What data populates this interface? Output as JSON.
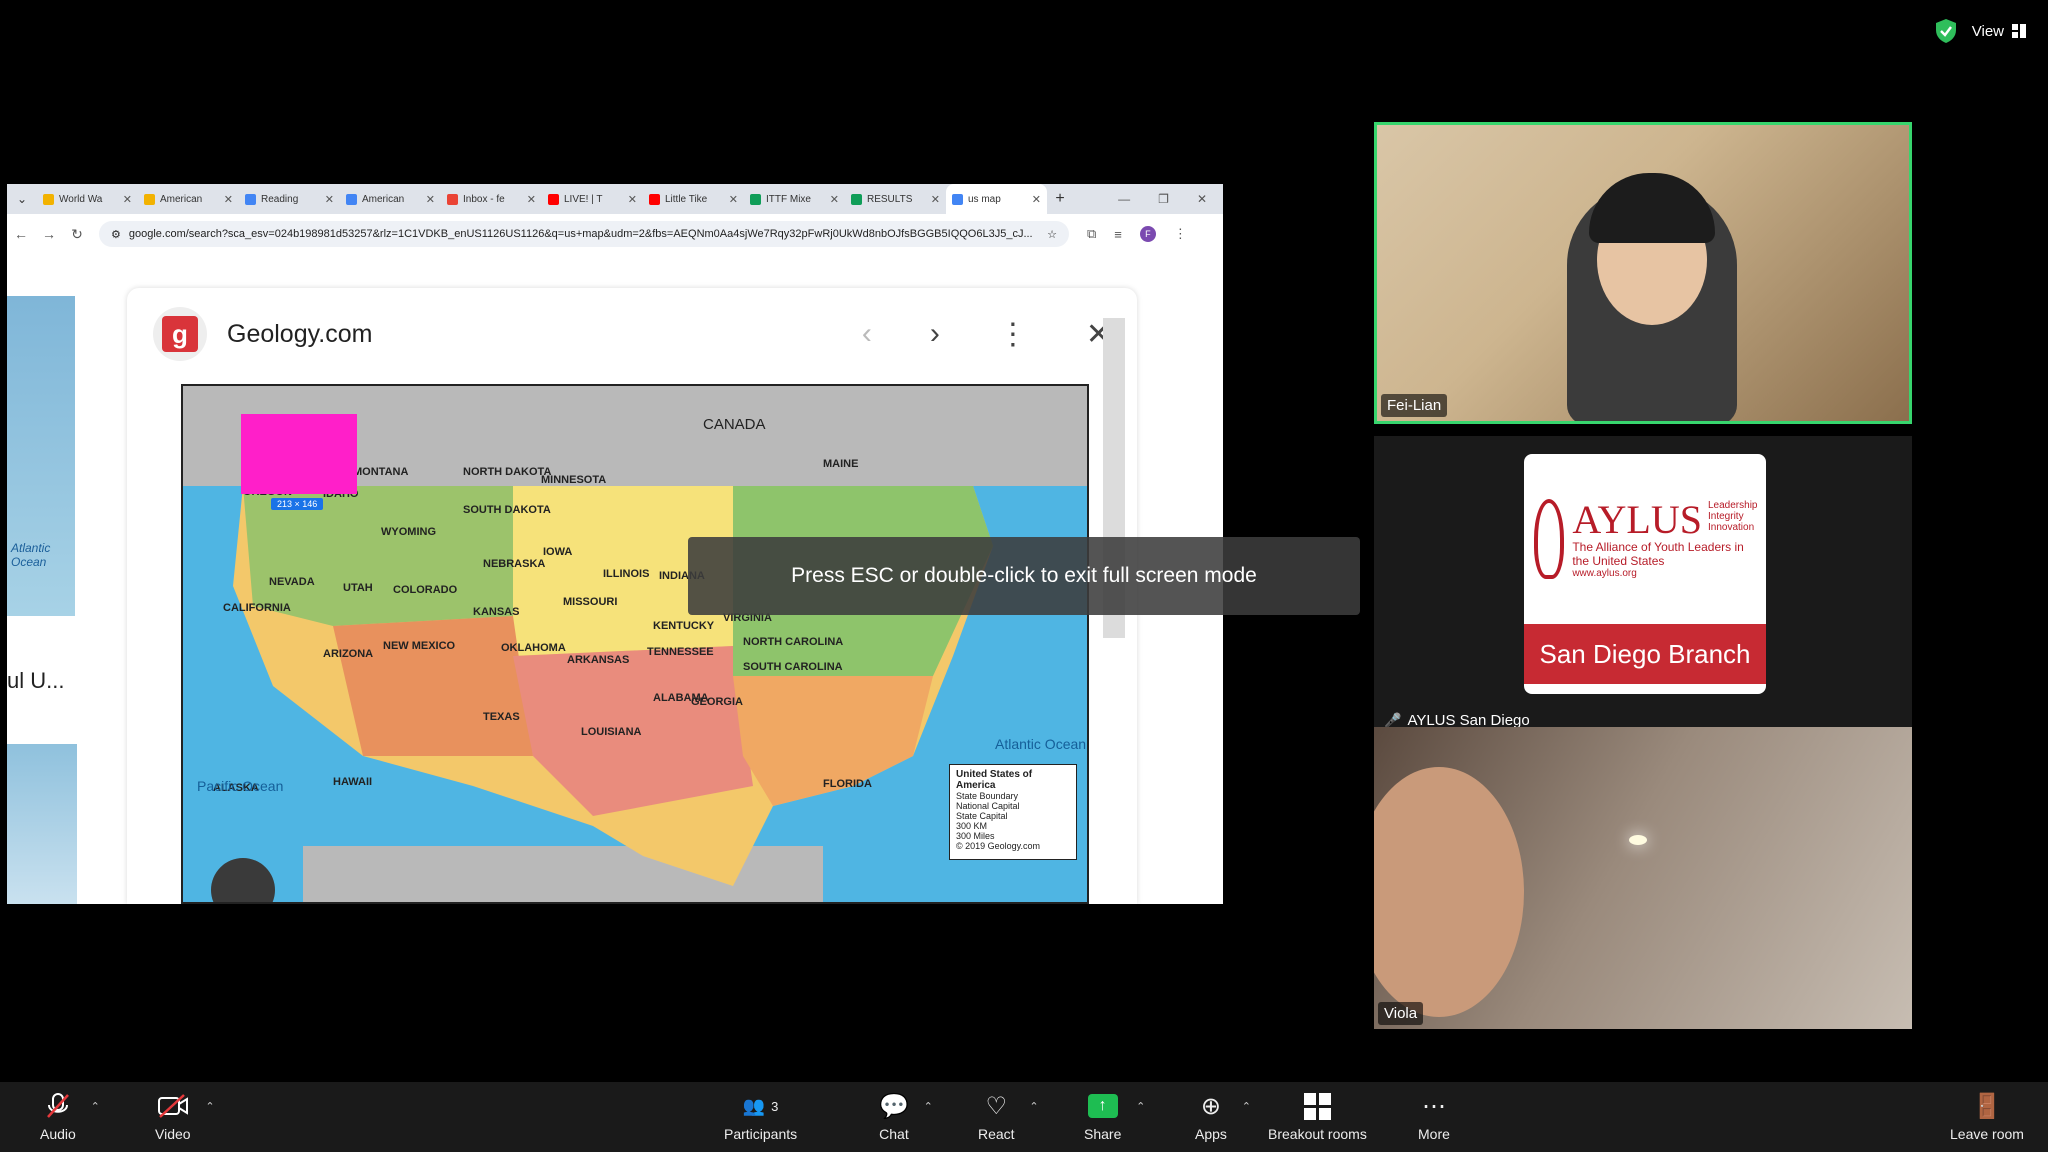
{
  "topbar": {
    "view_label": "View"
  },
  "browser": {
    "tabs": [
      {
        "label": "World Wa",
        "color": "#f2b200"
      },
      {
        "label": "American",
        "color": "#f2b200"
      },
      {
        "label": "Reading",
        "color": "#4285f4"
      },
      {
        "label": "American",
        "color": "#4285f4"
      },
      {
        "label": "Inbox - fe",
        "color": "#ea4335"
      },
      {
        "label": "LIVE! | T",
        "color": "#ff0000"
      },
      {
        "label": "Little Tike",
        "color": "#ff0000"
      },
      {
        "label": "ITTF Mixe",
        "color": "#0f9d58"
      },
      {
        "label": "RESULTS",
        "color": "#0f9d58"
      },
      {
        "label": "us map",
        "color": "#4285f4"
      }
    ],
    "url": "google.com/search?sca_esv=024b198981d53257&rlz=1C1VDKB_enUS1126US1126&q=us+map&udm=2&fbs=AEQNm0Aa4sjWe7Rqy32pFwRj0UkWd8nbOJfsBGGB5IQQO6L3J5_cJ..."
  },
  "google": {
    "left_text": "ul U...",
    "left_thumb_label": "Atlantic Ocean"
  },
  "panel": {
    "site": "Geology.com"
  },
  "map": {
    "countries": {
      "canada": "CANADA"
    },
    "size_label": "213 × 146",
    "legend": {
      "title": "United States of America",
      "items": [
        "State Boundary",
        "National Capital",
        "State Capital"
      ],
      "scale_km": "300 KM",
      "scale_mi": "300 Miles",
      "copyright": "© 2019 Geology.com"
    },
    "oceans": {
      "pacific": "Pacific Ocean",
      "atlantic": "Atlantic Ocean"
    },
    "states": [
      {
        "name": "MONTANA"
      },
      {
        "name": "NORTH DAKOTA"
      },
      {
        "name": "MINNESOTA"
      },
      {
        "name": "OREGON"
      },
      {
        "name": "IDAHO"
      },
      {
        "name": "WYOMING"
      },
      {
        "name": "SOUTH DAKOTA"
      },
      {
        "name": "NEVADA"
      },
      {
        "name": "UTAH"
      },
      {
        "name": "COLORADO"
      },
      {
        "name": "NEBRASKA"
      },
      {
        "name": "KANSAS"
      },
      {
        "name": "CALIFORNIA"
      },
      {
        "name": "ARIZONA"
      },
      {
        "name": "NEW MEXICO"
      },
      {
        "name": "OKLAHOMA"
      },
      {
        "name": "TEXAS"
      },
      {
        "name": "IOWA"
      },
      {
        "name": "MISSOURI"
      },
      {
        "name": "ARKANSAS"
      },
      {
        "name": "LOUISIANA"
      },
      {
        "name": "ILLINOIS"
      },
      {
        "name": "INDIANA"
      },
      {
        "name": "KENTUCKY"
      },
      {
        "name": "TENNESSEE"
      },
      {
        "name": "GEORGIA"
      },
      {
        "name": "ALABAMA"
      },
      {
        "name": "VIRGINIA"
      },
      {
        "name": "NORTH CAROLINA"
      },
      {
        "name": "SOUTH CAROLINA"
      },
      {
        "name": "MAINE"
      },
      {
        "name": "FLORIDA"
      },
      {
        "name": "ALASKA"
      },
      {
        "name": "HAWAII"
      }
    ]
  },
  "toast": "Press ESC or double-click to exit full screen mode",
  "participants": [
    {
      "name": "Fei-Lian"
    },
    {
      "name": "AYLUS San Diego"
    },
    {
      "name": "Viola"
    }
  ],
  "aylus": {
    "name": "AYLUS",
    "tagline": "The Alliance of Youth Leaders in the United States",
    "url": "www.aylus.org",
    "values": "Leadership Integrity Innovation",
    "branch": "San Diego Branch"
  },
  "toolbar": {
    "audio": "Audio",
    "video": "Video",
    "participants": "Participants",
    "participants_count": "3",
    "chat": "Chat",
    "react": "React",
    "share": "Share",
    "apps": "Apps",
    "breakout": "Breakout rooms",
    "more": "More",
    "leave": "Leave room"
  }
}
